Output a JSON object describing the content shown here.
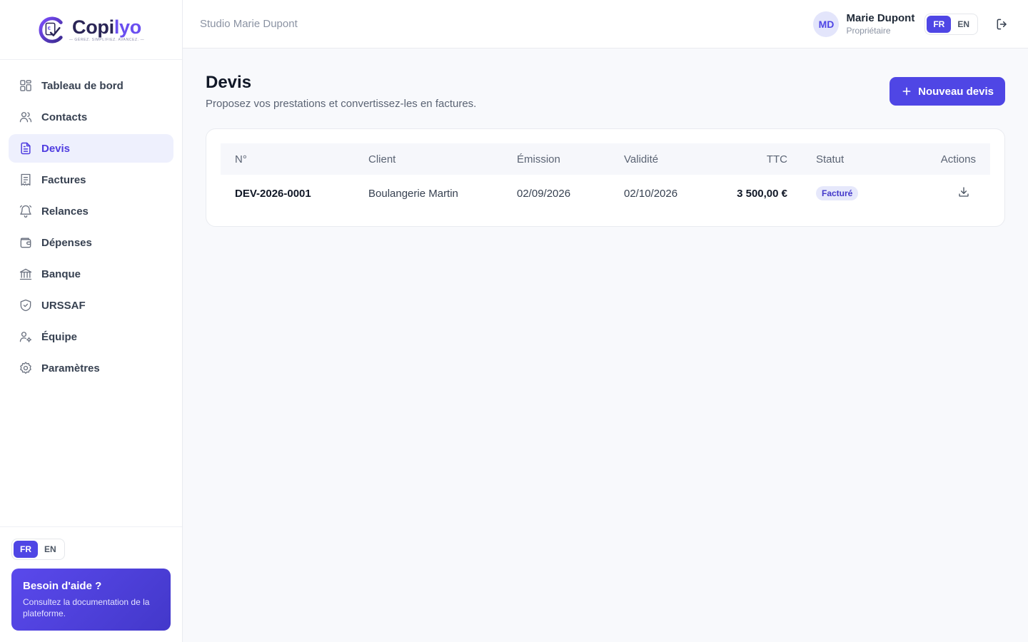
{
  "brand": {
    "name_part1": "Copi",
    "name_part2": "lyo",
    "tagline": "— GÉREZ. SIMPLIFIEZ. AVANCEZ. —",
    "accent_color": "#4f46e5"
  },
  "sidebar": {
    "items": [
      {
        "label": "Tableau de bord",
        "icon": "dashboard-icon",
        "active": false
      },
      {
        "label": "Contacts",
        "icon": "users-icon",
        "active": false
      },
      {
        "label": "Devis",
        "icon": "document-icon",
        "active": true
      },
      {
        "label": "Factures",
        "icon": "receipt-icon",
        "active": false
      },
      {
        "label": "Relances",
        "icon": "bell-icon",
        "active": false
      },
      {
        "label": "Dépenses",
        "icon": "wallet-icon",
        "active": false
      },
      {
        "label": "Banque",
        "icon": "bank-icon",
        "active": false
      },
      {
        "label": "URSSAF",
        "icon": "shield-icon",
        "active": false
      },
      {
        "label": "Équipe",
        "icon": "user-gear-icon",
        "active": false
      },
      {
        "label": "Paramètres",
        "icon": "gear-icon",
        "active": false
      }
    ],
    "lang": {
      "fr": "FR",
      "en": "EN",
      "selected": "FR"
    },
    "help": {
      "title": "Besoin d'aide ?",
      "text": "Consultez la documentation de la plateforme."
    }
  },
  "header": {
    "studio": "Studio Marie Dupont",
    "user": {
      "initials": "MD",
      "name": "Marie Dupont",
      "role": "Propriétaire"
    },
    "lang": {
      "fr": "FR",
      "en": "EN",
      "selected": "FR"
    }
  },
  "main": {
    "title": "Devis",
    "subtitle": "Proposez vos prestations et convertissez-les en factures.",
    "new_button": "Nouveau devis",
    "table": {
      "columns": [
        "N°",
        "Client",
        "Émission",
        "Validité",
        "TTC",
        "Statut",
        "Actions"
      ],
      "rows": [
        {
          "number": "DEV-2026-0001",
          "client": "Boulangerie Martin",
          "issued": "02/09/2026",
          "valid_until": "02/10/2026",
          "amount": "3 500,00 €",
          "status": "Facturé"
        }
      ]
    }
  }
}
